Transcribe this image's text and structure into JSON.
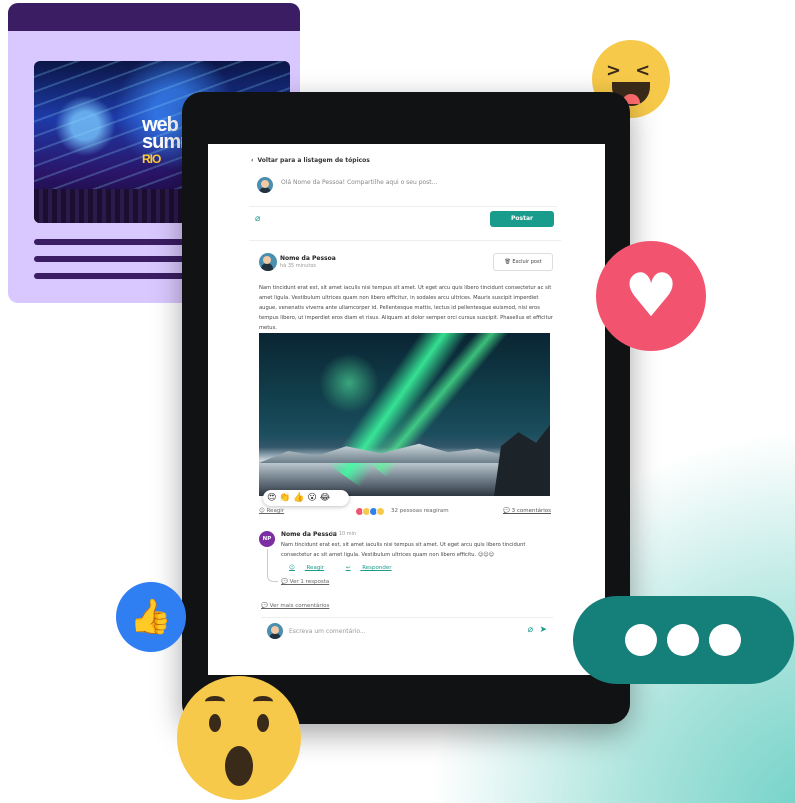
{
  "event_card": {
    "stage_title": "web",
    "stage_subtitle": "summit",
    "stage_city": "RIO"
  },
  "feed": {
    "back_link": "Voltar para a listagem de tópicos",
    "composer_placeholder": "Olá Nome da Pessoa! Compartilhe aqui o seu post...",
    "post_button": "Postar",
    "post": {
      "author": "Nome da Pessoa",
      "time": "há 35 minutos",
      "delete_label": "Excluir post",
      "body": "Nam tincidunt erat est, sit amet iaculis nisi tempus sit amet. Ut eget arcu quis libero tincidunt consectetur ac sit amet ligula. Vestibulum ultrices quam non libero efficitur, in sodales arcu ultrices. Mauris suscipit imperdiet augue, venenatis viverra ante ullamcorper id. Pellentesque mattis, lectus id pellentesque euismod, nisi eros tempus libero, ut imperdiet eros diam et risus. Aliquam at dolor semper orci cursus suscipit. Phasellus et efficitur metus.",
      "reaction_emojis": "😍 👏 👍 😮 😂",
      "react_label": "Reagir",
      "people_reacted": "32 pessoas reagiram",
      "comments_count": "3 comentários"
    },
    "comment": {
      "initials": "NP",
      "author": "Nome da Pessoa",
      "time": "há 10 min",
      "text": "Nam tincidunt erat est, sit amet iaculis nisi tempus sit amet. Ut eget arcu quis libero tincidunt consectetur ac sit amet ligula. Vestibulum ultrices quam non libero efficitu. 😊😊😊",
      "react_label": "Reagir",
      "reply_label": "Responder",
      "replies_link": "Ver 1 resposta"
    },
    "more_comments": "Ver mais comentários",
    "comment_placeholder": "Escreva um comentário..."
  },
  "colors": {
    "accent": "#1a9c8c",
    "heart": "#f2536e",
    "like": "#2f7ff2",
    "chat": "#157f7a",
    "event_card": "#d9c8ff"
  }
}
